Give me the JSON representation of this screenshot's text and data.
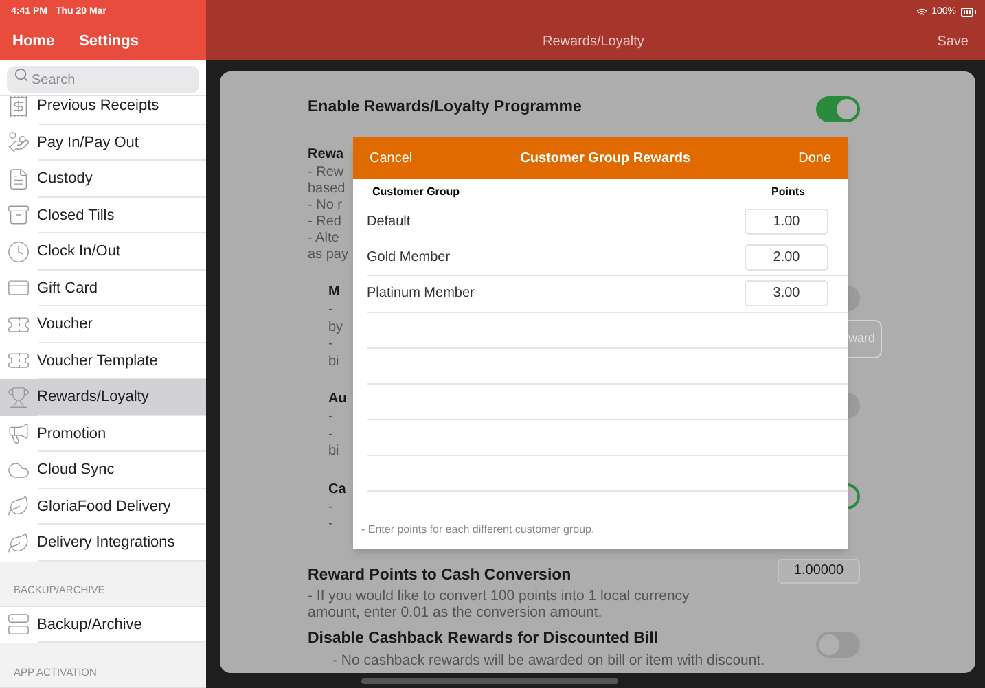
{
  "status_bar": {
    "time": "4:41 PM",
    "date": "Thu 20 Mar",
    "battery": "100%"
  },
  "sidebar": {
    "nav": [
      {
        "label": "Home"
      },
      {
        "label": "Settings"
      }
    ],
    "search": {
      "placeholder": "Search"
    },
    "items": [
      {
        "label": "Previous Receipts",
        "selected": false
      },
      {
        "label": "Pay In/Pay Out",
        "selected": false
      },
      {
        "label": "Custody",
        "selected": false
      },
      {
        "label": "Closed Tills",
        "selected": false
      },
      {
        "label": "Clock In/Out",
        "selected": false
      },
      {
        "label": "Gift Card",
        "selected": false
      },
      {
        "label": "Voucher",
        "selected": false
      },
      {
        "label": "Voucher Template",
        "selected": false
      },
      {
        "label": "Rewards/Loyalty",
        "selected": true
      },
      {
        "label": "Promotion",
        "selected": false
      },
      {
        "label": "Cloud Sync",
        "selected": false
      },
      {
        "label": "GloriaFood Delivery",
        "selected": false
      },
      {
        "label": "Delivery Integrations",
        "selected": false
      }
    ],
    "sections": [
      {
        "header": "BACKUP/ARCHIVE",
        "items": [
          {
            "label": "Backup/Archive",
            "selected": false
          }
        ]
      },
      {
        "header": "APP ACTIVATION"
      }
    ]
  },
  "header": {
    "title": "Rewards/Loyalty",
    "action": "Save"
  },
  "settings": {
    "enable": {
      "label": "Enable Rewards/Loyalty Programme",
      "on": true
    },
    "rewards_type": {
      "title": "Rewa",
      "lines": [
        "- Rew",
        "based",
        "- No r",
        "- Red",
        "- Alte",
        "as pay"
      ]
    },
    "options": [
      {
        "title": "M",
        "lines": [
          "-",
          "by",
          "-",
          "bi"
        ],
        "on": false,
        "button": "ward"
      },
      {
        "title": "Au",
        "lines": [
          "-",
          "-",
          "bi"
        ],
        "on": false
      },
      {
        "title": "Ca",
        "lines": [
          "-",
          "-"
        ],
        "on": true
      }
    ],
    "conversion": {
      "title": "Reward Points to Cash Conversion",
      "description": "- If you would like to convert 100 points into 1 local currency amount, enter 0.01 as the conversion amount.",
      "value": "1.00000"
    },
    "disable_cashback": {
      "title": "Disable Cashback Rewards for Discounted Bill",
      "description": "- No cashback rewards will be awarded on bill or item with discount.",
      "on": false
    }
  },
  "dialog": {
    "cancel": "Cancel",
    "title": "Customer Group Rewards",
    "done": "Done",
    "columns": [
      "Customer Group",
      "Points"
    ],
    "rows": [
      {
        "group": "Default",
        "points": "1.00"
      },
      {
        "group": "Gold Member",
        "points": "2.00"
      },
      {
        "group": "Platinum Member",
        "points": "3.00"
      }
    ],
    "note": "- Enter points for each different customer group."
  }
}
